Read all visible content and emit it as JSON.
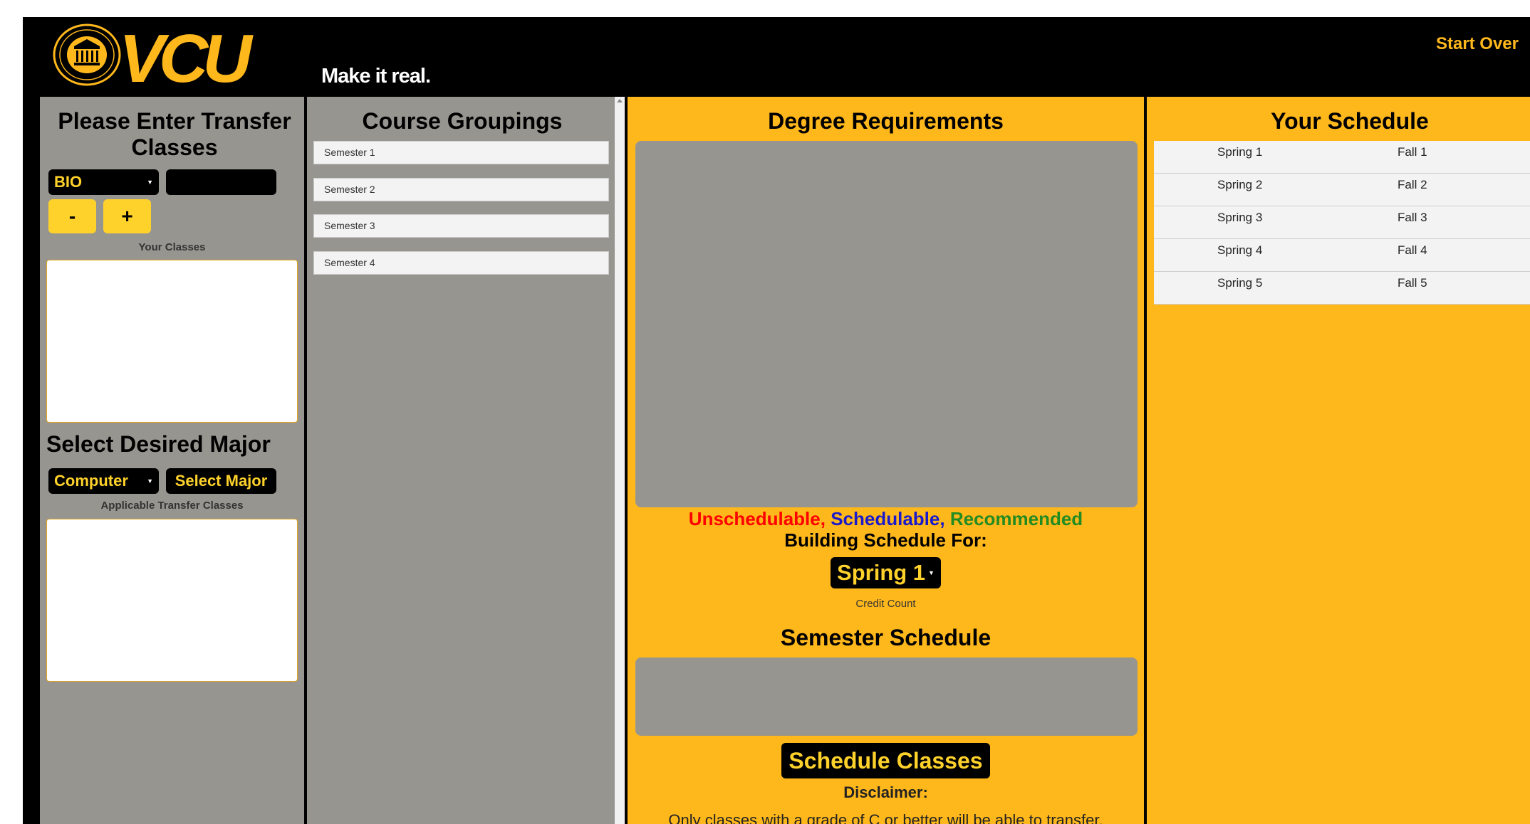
{
  "header": {
    "logo_text": "VCU",
    "tagline": "Make it real.",
    "start_over": "Start Over"
  },
  "transfer": {
    "title": "Please Enter Transfer Classes",
    "subject_select": "BIO",
    "course_input_value": "",
    "minus_label": "-",
    "plus_label": "+",
    "your_classes_label": "Your Classes",
    "major_title": "Select Desired Major",
    "major_select": "Computer",
    "select_major_button": "Select Major",
    "applicable_label": "Applicable Transfer Classes"
  },
  "groupings": {
    "title": "Course Groupings",
    "items": [
      "Semester 1",
      "Semester 2",
      "Semester 3",
      "Semester 4"
    ]
  },
  "degree": {
    "title": "Degree Requirements",
    "legend": {
      "unschedulable": "Unschedulable,",
      "schedulable": "Schedulable,",
      "recommended": "Recommended"
    },
    "building_label": "Building Schedule For:",
    "semester_select": "Spring 1",
    "credit_count_label": "Credit Count",
    "semester_schedule_title": "Semester Schedule",
    "schedule_button": "Schedule Classes",
    "disclaimer_title": "Disclaimer:",
    "disclaimer_text": "Only classes with a grade of C or better will be able to transfer."
  },
  "schedule": {
    "title": "Your Schedule",
    "rows": [
      {
        "spring": "Spring 1",
        "fall": "Fall 1"
      },
      {
        "spring": "Spring 2",
        "fall": "Fall 2"
      },
      {
        "spring": "Spring 3",
        "fall": "Fall 3"
      },
      {
        "spring": "Spring 4",
        "fall": "Fall 4"
      },
      {
        "spring": "Spring 5",
        "fall": "Fall 5"
      }
    ]
  },
  "colors": {
    "brand_gold": "#ffb81c",
    "button_yellow": "#ffd22b",
    "panel_gray": "#97958f",
    "unschedulable": "#ff0000",
    "schedulable": "#1a1acc",
    "recommended": "#228b22"
  },
  "icons": {
    "seal": "vcu-seal-icon",
    "dropdown": "caret-down-icon"
  }
}
